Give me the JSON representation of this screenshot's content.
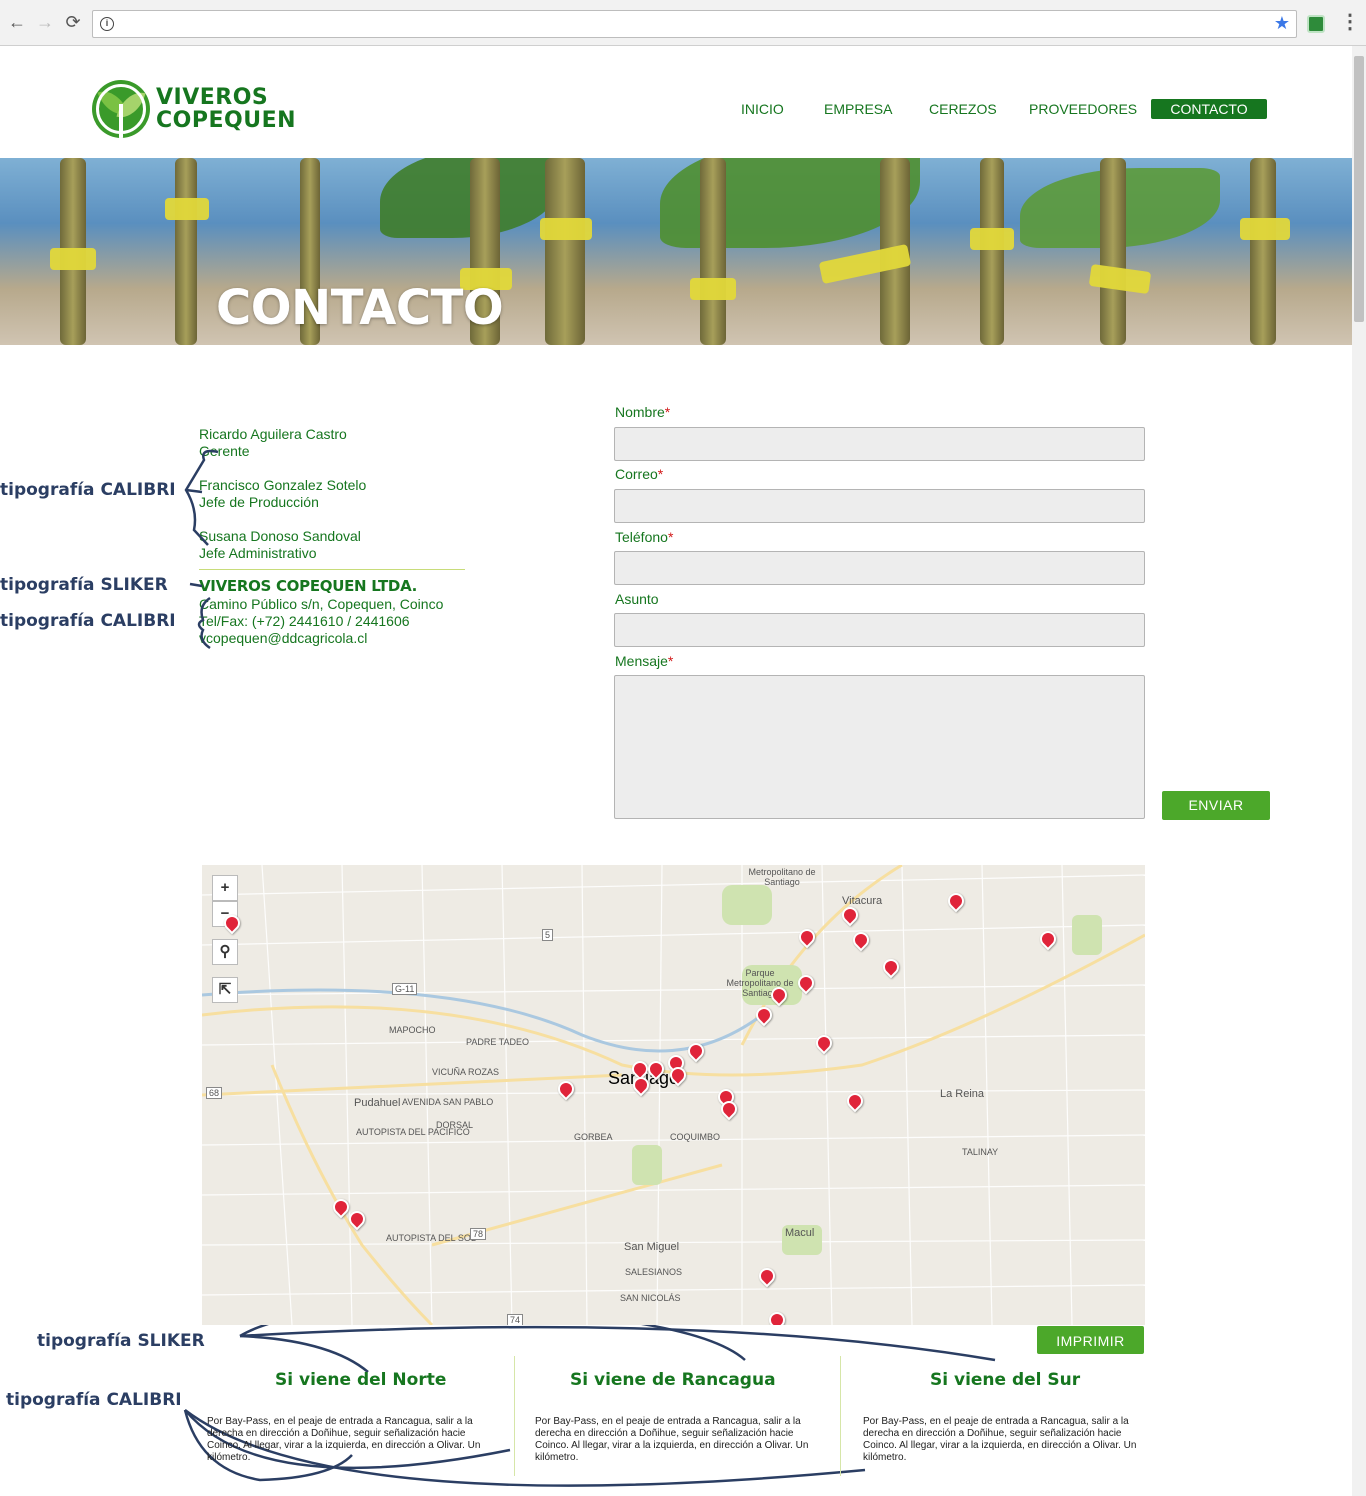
{
  "browser": {
    "url": "",
    "back_icon": "←",
    "forward_icon": "→",
    "reload_icon": "⟳",
    "info_icon": "i",
    "star_icon": "★",
    "menu_icon": "⋮"
  },
  "site": {
    "logo_line1": "VIVEROS",
    "logo_line2": "COPEQUEN",
    "nav": [
      "INICIO",
      "EMPRESA",
      "CEREZOS",
      "PROVEEDORES",
      "CONTACTO"
    ],
    "active_nav": "CONTACTO",
    "brand_color": "#16761f",
    "accent_color": "#4ca82a"
  },
  "banner": {
    "title": "CONTACTO"
  },
  "contacts": [
    {
      "name": "Ricardo Aguilera Castro",
      "role": "Gerente"
    },
    {
      "name": "Francisco Gonzalez Sotelo",
      "role": "Jefe de Producción"
    },
    {
      "name": "Susana Donoso Sandoval",
      "role": "Jefe Administrativo"
    }
  ],
  "company": {
    "name": "VIVEROS COPEQUEN LTDA.",
    "address": "Camino Público s/n, Copequen, Coinco",
    "phone": "Tel/Fax: (+72) 2441610 / 2441606",
    "email": "vcopequen@ddcagricola.cl"
  },
  "annotations": {
    "calibri": "tipografía CALIBRI",
    "sliker": "tipografía SLIKER"
  },
  "form": {
    "nombre": "Nombre",
    "correo": "Correo",
    "telefono": "Teléfono",
    "asunto": "Asunto",
    "mensaje": "Mensaje",
    "required_mark": "*",
    "submit": "ENVIAR"
  },
  "map": {
    "zoom_in": "+",
    "zoom_out": "−",
    "search_icon": "⚲",
    "external_icon": "⇱",
    "labels": {
      "santiago": "Santiago",
      "pudahuel": "Pudahuel",
      "la_reina": "La Reina",
      "macul": "Macul",
      "san_miguel": "San Miguel",
      "vitacura": "Vitacura",
      "parque_metropolitano": "Parque Metropolitano de Santiago",
      "metropolitano_top": "Metropolitano de Santiago",
      "talinay": "TALINAY",
      "mapocho": "MAPOCHO",
      "padre_tadeo": "PADRE TADEO",
      "vicuna_rozas": "VICUÑA ROZAS",
      "avenida_san_pablo": "AVENIDA SAN PABLO",
      "autopista_pacifico": "AUTOPISTA DEL PACIFICO",
      "autopista_sol": "AUTOPISTA DEL SOL",
      "gorbea": "GORBEA",
      "coquimbo": "COQUIMBO",
      "salesianos": "SALESIANOS",
      "san_nicolas": "SAN NICOLÁS",
      "dorsal": "DORSAL",
      "g11": "G-11",
      "r68": "68",
      "r78": "78",
      "r74": "74",
      "r5": "5"
    },
    "print": "IMPRIMIR"
  },
  "directions": [
    {
      "title": "Si viene del Norte",
      "text": "Por Bay-Pass, en el peaje de entrada a Rancagua, salir a la derecha en dirección a Doñihue, seguir señalización hacie Coinco. Al llegar, virar a la izquierda, en dirección a Olivar. Un kilómetro."
    },
    {
      "title": "Si viene de Rancagua",
      "text": "Por Bay-Pass, en el peaje de entrada a Rancagua, salir a la derecha en dirección a Doñihue, seguir señalización hacie Coinco. Al llegar, virar a la izquierda, en dirección a Olivar. Un kilómetro."
    },
    {
      "title": "Si viene del Sur",
      "text": "Por Bay-Pass, en el peaje de entrada a Rancagua, salir a la derecha en dirección a Doñihue, seguir señalización hacie Coinco. Al llegar, virar a la izquierda, en dirección a Olivar. Un kilómetro."
    }
  ]
}
